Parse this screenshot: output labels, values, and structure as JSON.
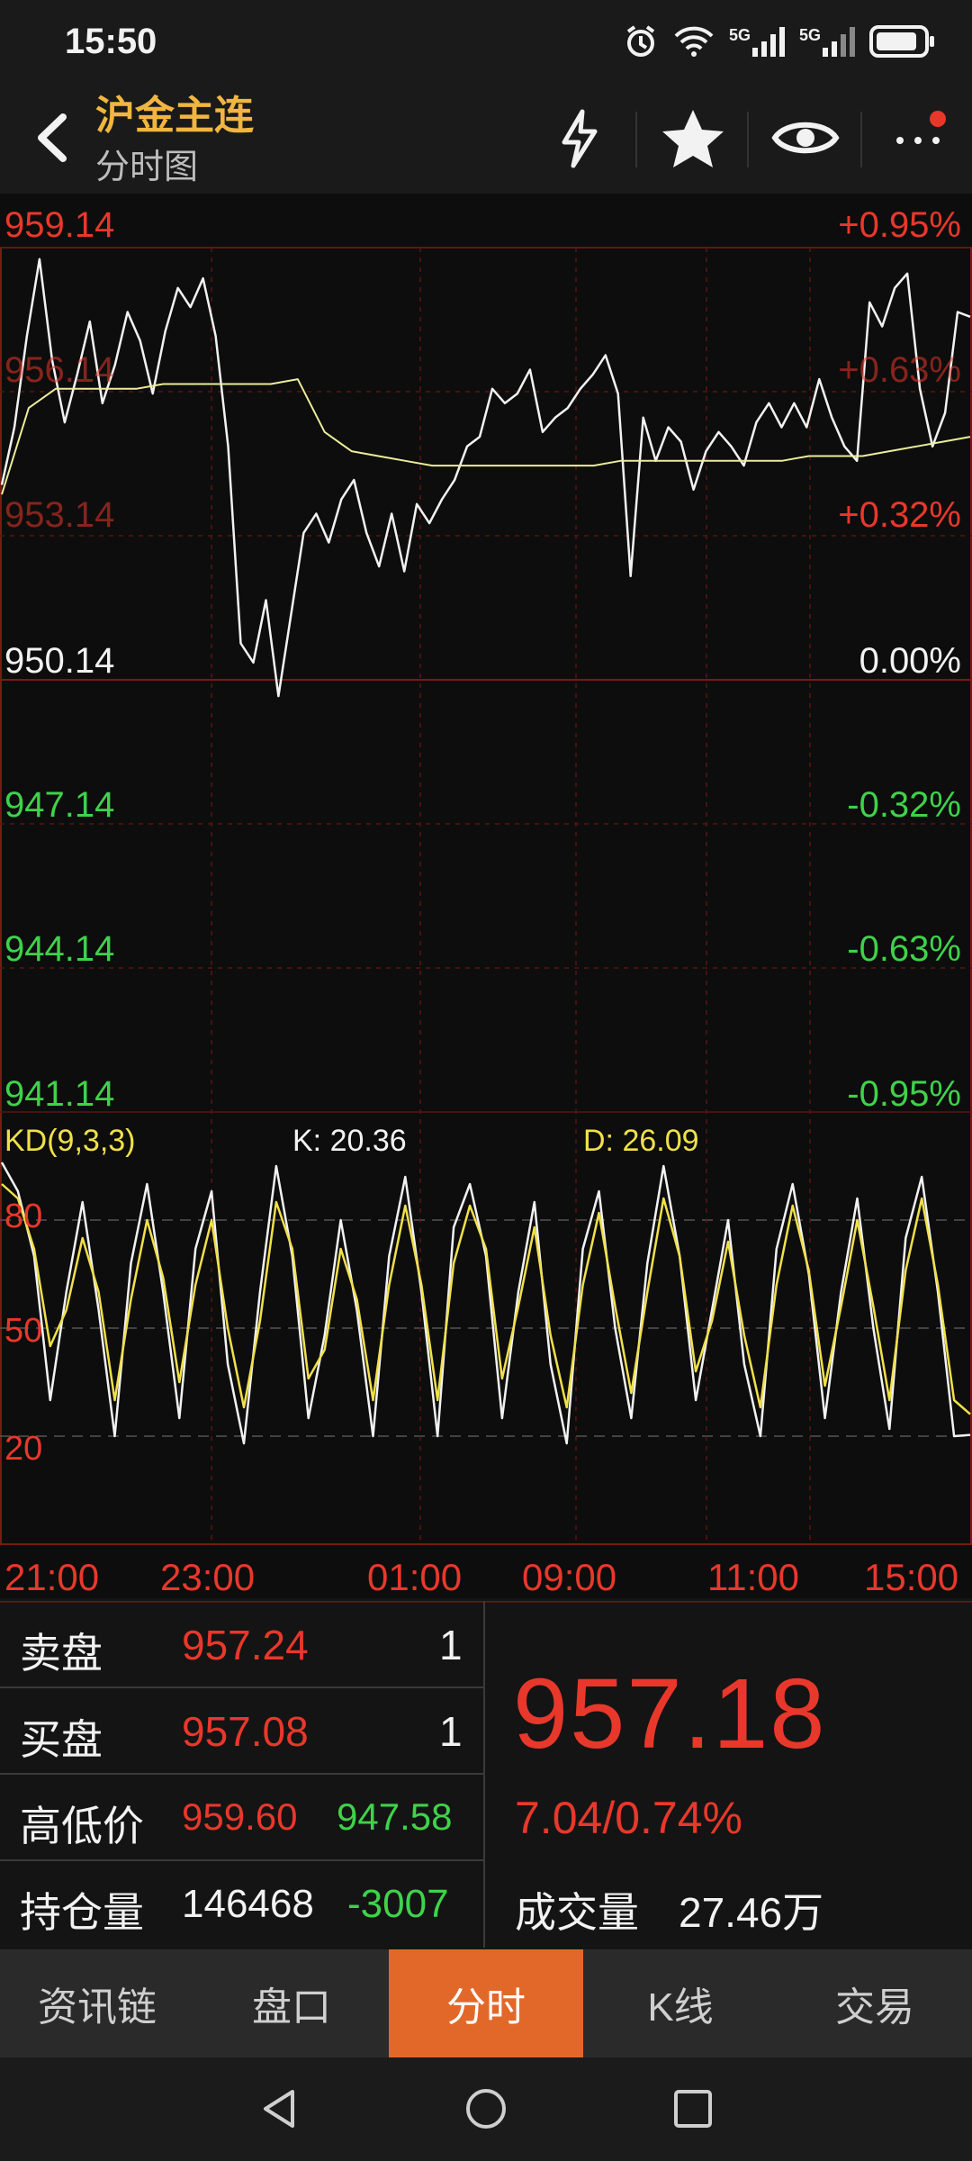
{
  "status_bar": {
    "time": "15:50",
    "icons": [
      "alarm-icon",
      "wifi-icon",
      "5g-signal-icon",
      "5g-signal-icon",
      "battery-icon"
    ],
    "signal_label_1": "5G",
    "signal_label_2": "5G"
  },
  "header": {
    "title": "沪金主连",
    "subtitle": "分时图",
    "icons": [
      "back-icon",
      "lightning-icon",
      "star-icon",
      "eye-icon",
      "more-icon"
    ]
  },
  "price_axis": {
    "left": [
      "959.14",
      "956.14",
      "953.14",
      "950.14",
      "947.14",
      "944.14",
      "941.14"
    ],
    "right": [
      "+0.95%",
      "+0.63%",
      "+0.32%",
      "0.00%",
      "-0.32%",
      "-0.63%",
      "-0.95%"
    ]
  },
  "kd": {
    "label": "KD(9,3,3)",
    "k": "K: 20.36",
    "d": "D: 26.09",
    "levels": [
      "80",
      "50",
      "20"
    ]
  },
  "time_axis": [
    "21:00",
    "23:00",
    "01:00",
    "09:00",
    "11:00",
    "15:00"
  ],
  "chart_data": [
    {
      "type": "line",
      "ylim": [
        941.14,
        959.14
      ],
      "reference": 950.14,
      "series": [
        {
          "values": [
            954.2,
            955.4,
            957.3,
            958.9,
            956.8,
            955.5,
            956.5,
            957.6,
            955.9,
            956.7,
            957.8,
            957.2,
            956.1,
            957.4,
            958.3,
            957.9,
            958.5,
            957.3,
            955.0,
            950.9,
            950.5,
            951.8,
            949.8,
            951.5,
            953.2,
            953.6,
            953.0,
            953.9,
            954.3,
            953.2,
            952.5,
            953.6,
            952.4,
            953.8,
            953.4,
            953.9,
            954.3,
            955.0,
            955.2,
            956.2,
            955.9,
            956.1,
            956.6,
            955.3,
            955.6,
            955.8,
            956.2,
            956.5,
            956.9,
            956.1,
            952.3,
            955.6,
            954.7,
            955.4,
            955.1,
            954.1,
            954.9,
            955.3,
            955.0,
            954.6,
            955.5,
            955.9,
            955.4,
            955.9,
            955.4,
            956.4,
            955.6,
            955.0,
            954.7,
            958.0,
            957.5,
            958.3,
            958.6,
            956.2,
            955.0,
            955.7,
            957.8,
            957.7
          ],
          "color": "#f2f2f2"
        },
        {
          "values": [
            954.0,
            955.8,
            956.2,
            956.2,
            956.2,
            956.2,
            956.3,
            956.3,
            956.3,
            956.3,
            956.3,
            956.4,
            955.3,
            954.9,
            954.8,
            954.7,
            954.6,
            954.6,
            954.6,
            954.6,
            954.6,
            954.6,
            954.6,
            954.7,
            954.7,
            954.7,
            954.7,
            954.7,
            954.7,
            954.7,
            954.8,
            954.8,
            954.8,
            954.9,
            955.0,
            955.1,
            955.2
          ],
          "color": "#ecec9a"
        }
      ]
    },
    {
      "type": "line",
      "ylim": [
        0,
        100
      ],
      "series": [
        {
          "name": "K",
          "values": [
            96,
            88,
            70,
            30,
            60,
            85,
            55,
            20,
            68,
            90,
            60,
            25,
            72,
            88,
            40,
            18,
            60,
            95,
            70,
            25,
            48,
            80,
            55,
            20,
            70,
            92,
            60,
            20,
            78,
            90,
            70,
            25,
            60,
            85,
            40,
            18,
            72,
            88,
            50,
            25,
            68,
            95,
            70,
            30,
            55,
            80,
            40,
            20,
            72,
            90,
            65,
            25,
            60,
            86,
            50,
            22,
            75,
            92,
            60,
            20,
            20.36
          ],
          "color": "#f2f2f2"
        },
        {
          "name": "D",
          "values": [
            90,
            86,
            72,
            45,
            55,
            75,
            60,
            30,
            58,
            80,
            64,
            35,
            62,
            80,
            50,
            28,
            52,
            85,
            72,
            36,
            44,
            72,
            58,
            30,
            62,
            84,
            62,
            30,
            68,
            84,
            72,
            36,
            56,
            78,
            48,
            28,
            62,
            82,
            56,
            32,
            60,
            86,
            70,
            38,
            52,
            74,
            48,
            28,
            62,
            84,
            66,
            34,
            56,
            80,
            56,
            30,
            66,
            86,
            62,
            30,
            26.09
          ],
          "color": "#f0e04a"
        }
      ]
    }
  ],
  "quote": {
    "sell_label": "卖盘",
    "sell_price": "957.24",
    "sell_qty": "1",
    "buy_label": "买盘",
    "buy_price": "957.08",
    "buy_qty": "1",
    "hilo_label": "高低价",
    "high": "959.60",
    "low": "947.58",
    "oi_label": "持仓量",
    "oi": "146468",
    "oi_change": "-3007",
    "last_price": "957.18",
    "change": "7.04/0.74%",
    "volume_label": "成交量",
    "volume": "27.46万"
  },
  "tabs": [
    {
      "label": "资讯链"
    },
    {
      "label": "盘口"
    },
    {
      "label": "分时",
      "active": true
    },
    {
      "label": "K线"
    },
    {
      "label": "交易"
    }
  ],
  "nav": [
    "back-nav-icon",
    "home-nav-icon",
    "recents-nav-icon"
  ]
}
